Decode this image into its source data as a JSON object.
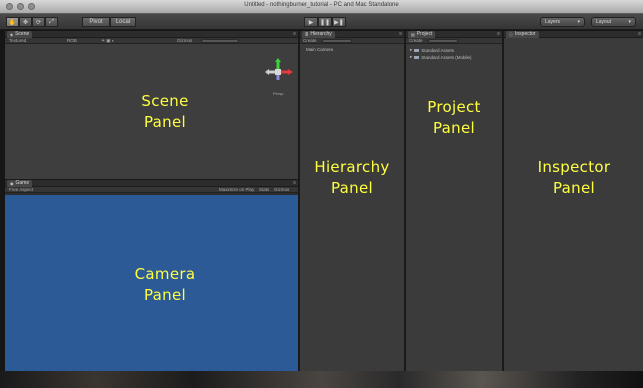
{
  "window": {
    "title": "Untitled - nothingburner_tutorial - PC and Mac Standalone"
  },
  "toolbar": {
    "tools": [
      "✋",
      "✥",
      "⟳",
      "⤢"
    ],
    "pivot_buttons": [
      "Pivot",
      "Local"
    ],
    "play": "▶",
    "pause": "❚❚",
    "step": "▶❚",
    "layers_label": "Layers",
    "layout_label": "Layout"
  },
  "scene": {
    "tab": "Scene",
    "draw_mode": "Textured",
    "render_mode": "RGB",
    "gizmos": "Gizmos",
    "search": "All",
    "persp": "Persp",
    "label_line1": "Scene",
    "label_line2": "Panel"
  },
  "game": {
    "tab": "Game",
    "aspect": "Free Aspect",
    "maximize": "Maximize on Play",
    "stats": "Stats",
    "gizmos": "Gizmos",
    "label_line1": "Camera",
    "label_line2": "Panel",
    "background": "#2c5a96"
  },
  "hierarchy": {
    "tab": "Hierarchy",
    "create": "Create",
    "search": "All",
    "items": [
      "Main Camera"
    ],
    "label_line1": "Hierarchy",
    "label_line2": "Panel"
  },
  "project": {
    "tab": "Project",
    "create": "Create",
    "items": [
      "Standard Assets",
      "Standard Assets (Mobile)"
    ],
    "label_line1": "Project",
    "label_line2": "Panel"
  },
  "inspector": {
    "tab": "Inspector",
    "label_line1": "Inspector",
    "label_line2": "Panel"
  },
  "colors": {
    "label": "#ffff40",
    "game_bg": "#2c5a96",
    "panel_bg": "#3b3b3b"
  }
}
